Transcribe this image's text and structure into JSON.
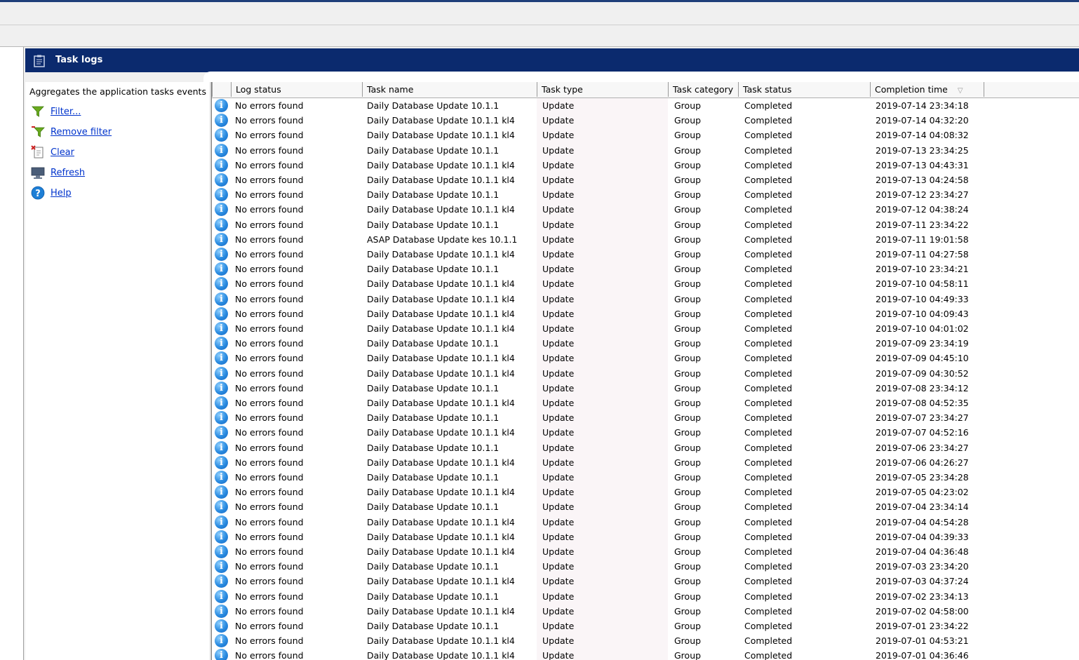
{
  "panel": {
    "title": "Task logs",
    "description": "Aggregates the application tasks events",
    "actions": [
      {
        "label": "Filter...",
        "icon": "filter-icon"
      },
      {
        "label": "Remove filter",
        "icon": "remove-filter-icon"
      },
      {
        "label": "Clear",
        "icon": "clear-icon"
      },
      {
        "label": "Refresh",
        "icon": "refresh-icon"
      },
      {
        "label": "Help",
        "icon": "help-icon"
      }
    ]
  },
  "table": {
    "columns": [
      "Log status",
      "Task name",
      "Task type",
      "Task category",
      "Task status",
      "Completion time"
    ],
    "sort_column": "Completion time",
    "sort_direction": "descending",
    "rows": [
      [
        "No errors found",
        "Daily Database Update 10.1.1",
        "Update",
        "Group",
        "Completed",
        "2019-07-14 23:34:18"
      ],
      [
        "No errors found",
        "Daily Database Update 10.1.1 kl4",
        "Update",
        "Group",
        "Completed",
        "2019-07-14 04:32:20"
      ],
      [
        "No errors found",
        "Daily Database Update 10.1.1 kl4",
        "Update",
        "Group",
        "Completed",
        "2019-07-14 04:08:32"
      ],
      [
        "No errors found",
        "Daily Database Update 10.1.1",
        "Update",
        "Group",
        "Completed",
        "2019-07-13 23:34:25"
      ],
      [
        "No errors found",
        "Daily Database Update 10.1.1 kl4",
        "Update",
        "Group",
        "Completed",
        "2019-07-13 04:43:31"
      ],
      [
        "No errors found",
        "Daily Database Update 10.1.1 kl4",
        "Update",
        "Group",
        "Completed",
        "2019-07-13 04:24:58"
      ],
      [
        "No errors found",
        "Daily Database Update 10.1.1",
        "Update",
        "Group",
        "Completed",
        "2019-07-12 23:34:27"
      ],
      [
        "No errors found",
        "Daily Database Update 10.1.1 kl4",
        "Update",
        "Group",
        "Completed",
        "2019-07-12 04:38:24"
      ],
      [
        "No errors found",
        "Daily Database Update 10.1.1",
        "Update",
        "Group",
        "Completed",
        "2019-07-11 23:34:22"
      ],
      [
        "No errors found",
        "ASAP Database Update kes 10.1.1",
        "Update",
        "Group",
        "Completed",
        "2019-07-11 19:01:58"
      ],
      [
        "No errors found",
        "Daily Database Update 10.1.1 kl4",
        "Update",
        "Group",
        "Completed",
        "2019-07-11 04:27:58"
      ],
      [
        "No errors found",
        "Daily Database Update 10.1.1",
        "Update",
        "Group",
        "Completed",
        "2019-07-10 23:34:21"
      ],
      [
        "No errors found",
        "Daily Database Update 10.1.1 kl4",
        "Update",
        "Group",
        "Completed",
        "2019-07-10 04:58:11"
      ],
      [
        "No errors found",
        "Daily Database Update 10.1.1 kl4",
        "Update",
        "Group",
        "Completed",
        "2019-07-10 04:49:33"
      ],
      [
        "No errors found",
        "Daily Database Update 10.1.1 kl4",
        "Update",
        "Group",
        "Completed",
        "2019-07-10 04:09:43"
      ],
      [
        "No errors found",
        "Daily Database Update 10.1.1 kl4",
        "Update",
        "Group",
        "Completed",
        "2019-07-10 04:01:02"
      ],
      [
        "No errors found",
        "Daily Database Update 10.1.1",
        "Update",
        "Group",
        "Completed",
        "2019-07-09 23:34:19"
      ],
      [
        "No errors found",
        "Daily Database Update 10.1.1 kl4",
        "Update",
        "Group",
        "Completed",
        "2019-07-09 04:45:10"
      ],
      [
        "No errors found",
        "Daily Database Update 10.1.1 kl4",
        "Update",
        "Group",
        "Completed",
        "2019-07-09 04:30:52"
      ],
      [
        "No errors found",
        "Daily Database Update 10.1.1",
        "Update",
        "Group",
        "Completed",
        "2019-07-08 23:34:12"
      ],
      [
        "No errors found",
        "Daily Database Update 10.1.1 kl4",
        "Update",
        "Group",
        "Completed",
        "2019-07-08 04:52:35"
      ],
      [
        "No errors found",
        "Daily Database Update 10.1.1",
        "Update",
        "Group",
        "Completed",
        "2019-07-07 23:34:27"
      ],
      [
        "No errors found",
        "Daily Database Update 10.1.1 kl4",
        "Update",
        "Group",
        "Completed",
        "2019-07-07 04:52:16"
      ],
      [
        "No errors found",
        "Daily Database Update 10.1.1",
        "Update",
        "Group",
        "Completed",
        "2019-07-06 23:34:27"
      ],
      [
        "No errors found",
        "Daily Database Update 10.1.1 kl4",
        "Update",
        "Group",
        "Completed",
        "2019-07-06 04:26:27"
      ],
      [
        "No errors found",
        "Daily Database Update 10.1.1",
        "Update",
        "Group",
        "Completed",
        "2019-07-05 23:34:28"
      ],
      [
        "No errors found",
        "Daily Database Update 10.1.1 kl4",
        "Update",
        "Group",
        "Completed",
        "2019-07-05 04:23:02"
      ],
      [
        "No errors found",
        "Daily Database Update 10.1.1",
        "Update",
        "Group",
        "Completed",
        "2019-07-04 23:34:14"
      ],
      [
        "No errors found",
        "Daily Database Update 10.1.1 kl4",
        "Update",
        "Group",
        "Completed",
        "2019-07-04 04:54:28"
      ],
      [
        "No errors found",
        "Daily Database Update 10.1.1 kl4",
        "Update",
        "Group",
        "Completed",
        "2019-07-04 04:39:33"
      ],
      [
        "No errors found",
        "Daily Database Update 10.1.1 kl4",
        "Update",
        "Group",
        "Completed",
        "2019-07-04 04:36:48"
      ],
      [
        "No errors found",
        "Daily Database Update 10.1.1",
        "Update",
        "Group",
        "Completed",
        "2019-07-03 23:34:20"
      ],
      [
        "No errors found",
        "Daily Database Update 10.1.1 kl4",
        "Update",
        "Group",
        "Completed",
        "2019-07-03 04:37:24"
      ],
      [
        "No errors found",
        "Daily Database Update 10.1.1",
        "Update",
        "Group",
        "Completed",
        "2019-07-02 23:34:13"
      ],
      [
        "No errors found",
        "Daily Database Update 10.1.1 kl4",
        "Update",
        "Group",
        "Completed",
        "2019-07-02 04:58:00"
      ],
      [
        "No errors found",
        "Daily Database Update 10.1.1",
        "Update",
        "Group",
        "Completed",
        "2019-07-01 23:34:22"
      ],
      [
        "No errors found",
        "Daily Database Update 10.1.1 kl4",
        "Update",
        "Group",
        "Completed",
        "2019-07-01 04:53:21"
      ],
      [
        "No errors found",
        "Daily Database Update 10.1.1 kl4",
        "Update",
        "Group",
        "Completed",
        "2019-07-01 04:36:46"
      ]
    ]
  },
  "colors": {
    "title_bar": "#0b2a6e",
    "link": "#0033cc",
    "info_icon": "#2a8be0"
  }
}
